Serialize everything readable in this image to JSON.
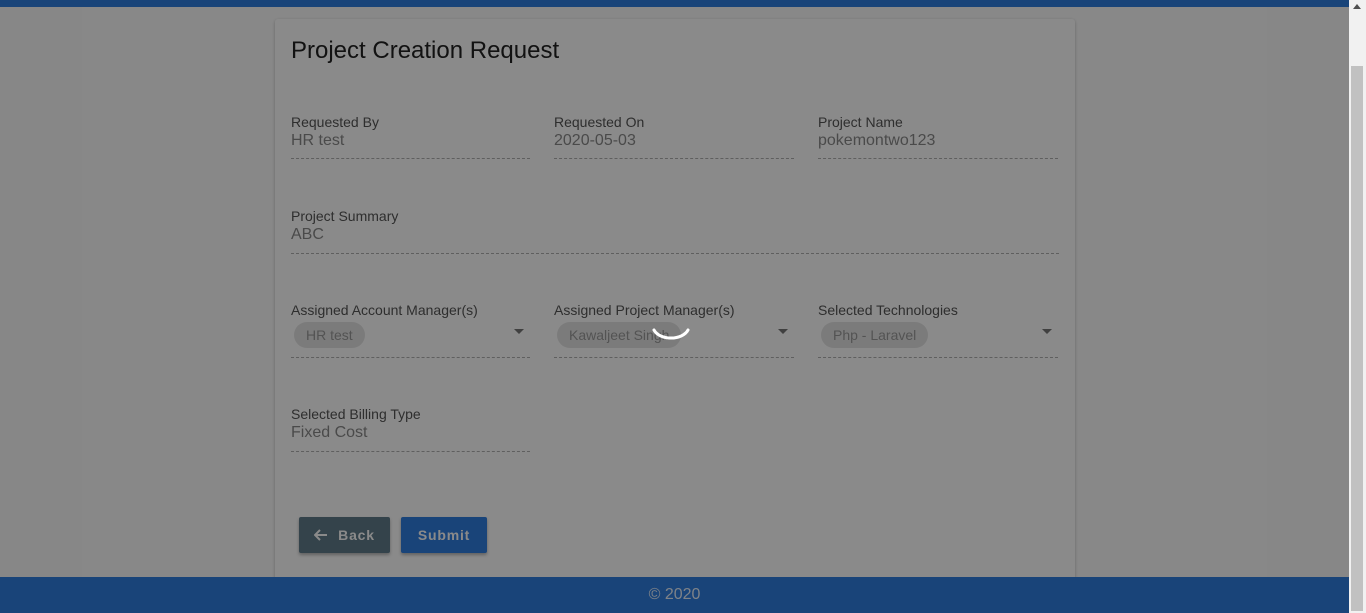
{
  "form": {
    "title": "Project Creation Request",
    "requested_by": {
      "label": "Requested By",
      "value": "HR test"
    },
    "requested_on": {
      "label": "Requested On",
      "value": "2020-05-03"
    },
    "project_name": {
      "label": "Project Name",
      "value": "pokemontwo123"
    },
    "project_summary": {
      "label": "Project Summary",
      "value": "ABC"
    },
    "account_managers": {
      "label": "Assigned Account Manager(s)",
      "chips": [
        "HR test"
      ]
    },
    "project_managers": {
      "label": "Assigned Project Manager(s)",
      "chips": [
        "Kawaljeet Singh"
      ]
    },
    "technologies": {
      "label": "Selected Technologies",
      "chips": [
        "Php - Laravel"
      ]
    },
    "billing_type": {
      "label": "Selected Billing Type",
      "value": "Fixed Cost"
    }
  },
  "buttons": {
    "back_label": "Back",
    "submit_label": "Submit"
  },
  "footer": {
    "text": "© 2020"
  },
  "colors": {
    "primary": "#2f7ee0",
    "back_button": "#607d8b",
    "overlay": "rgba(0,0,0,0.46)"
  },
  "icons": {
    "back": "arrow-left-icon",
    "dropdown": "caret-down-icon",
    "loading": "spinner-icon"
  }
}
